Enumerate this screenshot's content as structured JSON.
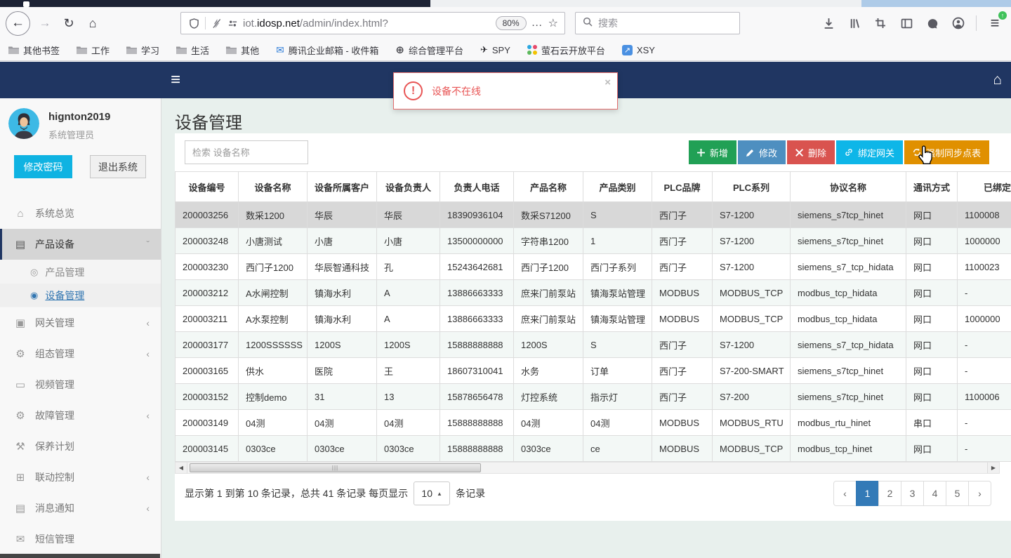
{
  "browser": {
    "url": {
      "subdomain": "iot.",
      "domain": "idosp.net",
      "path": "/admin/index.html?"
    },
    "zoom_level": "80%",
    "search_placeholder": "搜索",
    "bookmarks": [
      {
        "label": "其他书签",
        "icon": "folder-icon"
      },
      {
        "label": "工作",
        "icon": "folder-icon"
      },
      {
        "label": "学习",
        "icon": "folder-icon"
      },
      {
        "label": "生活",
        "icon": "folder-icon"
      },
      {
        "label": "其他",
        "icon": "folder-icon"
      },
      {
        "label": "腾讯企业邮箱 - 收件箱",
        "icon": "mail-icon"
      },
      {
        "label": "综合管理平台",
        "icon": "globe-icon"
      },
      {
        "label": "SPY",
        "icon": "plane-icon"
      },
      {
        "label": "萤石云开放平台",
        "icon": "dots-icon"
      },
      {
        "label": "XSY",
        "icon": "link-arrow-icon"
      }
    ]
  },
  "toast": {
    "message": "设备不在线"
  },
  "sidebar": {
    "user": {
      "name": "hignton2019",
      "role": "系统管理员"
    },
    "change_password": "修改密码",
    "logout": "退出系统",
    "menu": [
      {
        "label": "系统总览",
        "icon": "home-icon"
      },
      {
        "label": "产品设备",
        "icon": "book-icon",
        "state": "open",
        "active": true,
        "children": [
          {
            "label": "产品管理",
            "icon": "circle-o-icon"
          },
          {
            "label": "设备管理",
            "icon": "dot-circle-icon",
            "active": true
          }
        ]
      },
      {
        "label": "网关管理",
        "icon": "gateway-icon",
        "state": "collapsed"
      },
      {
        "label": "组态管理",
        "icon": "gears-icon",
        "state": "collapsed"
      },
      {
        "label": "视频管理",
        "icon": "monitor-icon"
      },
      {
        "label": "故障管理",
        "icon": "gears-icon",
        "state": "collapsed"
      },
      {
        "label": "保养计划",
        "icon": "wrench-icon"
      },
      {
        "label": "联动控制",
        "icon": "sitemap-icon",
        "state": "collapsed"
      },
      {
        "label": "消息通知",
        "icon": "book-icon",
        "state": "collapsed"
      },
      {
        "label": "短信管理",
        "icon": "envelope-icon"
      }
    ]
  },
  "page": {
    "title": "设备管理",
    "search_placeholder": "检索 设备名称",
    "buttons": [
      {
        "label": "新增",
        "icon": "plus-icon",
        "color": "#21a055"
      },
      {
        "label": "修改",
        "icon": "pencil-icon",
        "color": "#4e8fc0"
      },
      {
        "label": "删除",
        "icon": "cross-icon",
        "color": "#d9534f"
      },
      {
        "label": "绑定网关",
        "icon": "link-icon",
        "color": "#0eb6e8"
      },
      {
        "label": "强制同步点表",
        "icon": "refresh-icon",
        "color": "#e09000"
      }
    ],
    "table": {
      "columns": [
        "设备编号",
        "设备名称",
        "设备所属客户",
        "设备负责人",
        "负责人电话",
        "产品名称",
        "产品类别",
        "PLC品牌",
        "PLC系列",
        "协议名称",
        "通讯方式",
        "已绑定网关"
      ],
      "selected_row": 0,
      "rows": [
        [
          "200003256",
          "数采1200",
          "华辰",
          "华辰",
          "18390936104",
          "数采S71200",
          "S",
          "西门子",
          "S7-1200",
          "siemens_s7tcp_hinet",
          "网口",
          "1100008"
        ],
        [
          "200003248",
          "小唐测试",
          "小唐",
          "小唐",
          "13500000000",
          "字符串1200",
          "1",
          "西门子",
          "S7-1200",
          "siemens_s7tcp_hinet",
          "网口",
          "1000000"
        ],
        [
          "200003230",
          "西门子1200",
          "华辰智通科技",
          "孔",
          "15243642681",
          "西门子1200",
          "西门子系列",
          "西门子",
          "S7-1200",
          "siemens_s7_tcp_hidata",
          "网口",
          "1100023"
        ],
        [
          "200003212",
          "A水闸控制",
          "镇海水利",
          "A",
          "13886663333",
          "庶来门前泵站",
          "镇海泵站管理",
          "MODBUS",
          "MODBUS_TCP",
          "modbus_tcp_hidata",
          "网口",
          "-"
        ],
        [
          "200003211",
          "A水泵控制",
          "镇海水利",
          "A",
          "13886663333",
          "庶来门前泵站",
          "镇海泵站管理",
          "MODBUS",
          "MODBUS_TCP",
          "modbus_tcp_hidata",
          "网口",
          "1000000"
        ],
        [
          "200003177",
          "1200SSSSSS",
          "1200S",
          "1200S",
          "15888888888",
          "1200S",
          "S",
          "西门子",
          "S7-1200",
          "siemens_s7_tcp_hidata",
          "网口",
          "-"
        ],
        [
          "200003165",
          "供水",
          "医院",
          "王",
          "18607310041",
          "水务",
          "订单",
          "西门子",
          "S7-200-SMART",
          "siemens_s7tcp_hinet",
          "网口",
          "-"
        ],
        [
          "200003152",
          "控制demo",
          "31",
          "13",
          "15878656478",
          "灯控系统",
          "指示灯",
          "西门子",
          "S7-200",
          "siemens_s7tcp_hinet",
          "网口",
          "1100006"
        ],
        [
          "200003149",
          "04测",
          "04测",
          "04测",
          "15888888888",
          "04测",
          "04测",
          "MODBUS",
          "MODBUS_RTU",
          "modbus_rtu_hinet",
          "串口",
          "-"
        ],
        [
          "200003145",
          "0303ce",
          "0303ce",
          "0303ce",
          "15888888888",
          "0303ce",
          "ce",
          "MODBUS",
          "MODBUS_TCP",
          "modbus_tcp_hinet",
          "网口",
          "-"
        ]
      ]
    },
    "footer": {
      "summary_prefix": "显示第 1 到第 10 条记录，总共 41 条记录 每页显示",
      "page_size": "10",
      "summary_suffix": "条记录",
      "pagination": {
        "prev": "‹",
        "next": "›",
        "pages": [
          "1",
          "2",
          "3",
          "4",
          "5"
        ],
        "active": "1"
      }
    }
  },
  "icon_glyphs": {
    "home-icon": "⌂",
    "book-icon": "▤",
    "gateway-icon": "▣",
    "gears-icon": "⚙",
    "monitor-icon": "▭",
    "wrench-icon": "⚒",
    "sitemap-icon": "⊞",
    "envelope-icon": "✉",
    "circle-o-icon": "◎",
    "dot-circle-icon": "◉",
    "chevron-down": "ˇ",
    "chevron-left": "‹",
    "close": "×",
    "caret-up": "▲",
    "scroll-left": "◀",
    "scroll-right": "▶",
    "grip": "|||",
    "dots": "…",
    "star": "☆",
    "back": "←",
    "forward": "→",
    "reload": "↻",
    "browser-home": "⌂",
    "hamburger": "≡",
    "update-arrow": "↑"
  },
  "colors": {
    "navbar": "#203662",
    "pagination_active": "#337ab7",
    "alert_red": "#e85555",
    "dots_icon": [
      "#2aa7e0",
      "#e64a6b",
      "#5cb85c",
      "#f2c200"
    ]
  }
}
